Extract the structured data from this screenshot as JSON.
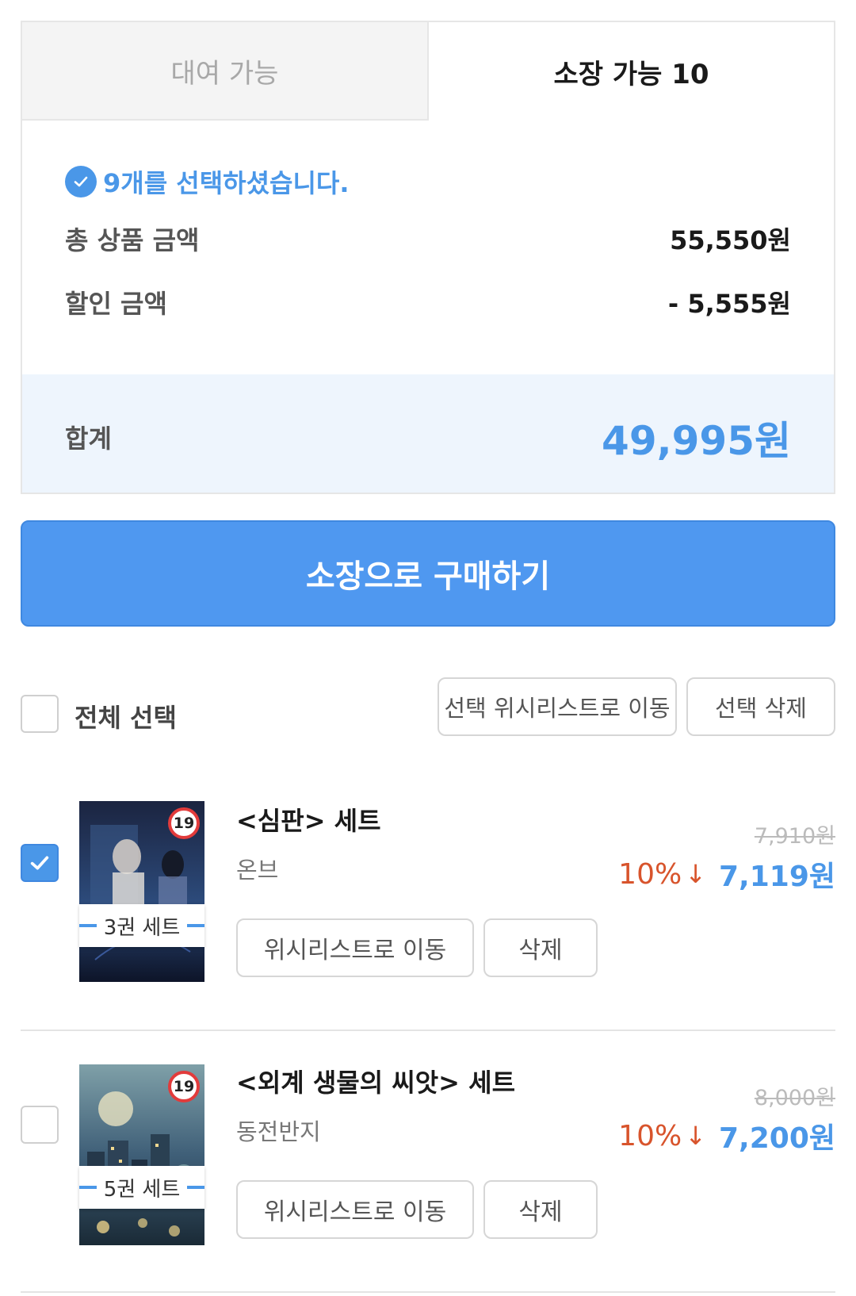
{
  "tabs": {
    "rent_label": "대여 가능",
    "own_label": "소장 가능 10"
  },
  "summary": {
    "selected_msg": "9개를 선택하셨습니다.",
    "total_label": "총 상품 금액",
    "total_value": "55,550원",
    "discount_label": "할인 금액",
    "discount_value": "- 5,555원",
    "sum_label": "합계",
    "sum_value": "49,995원",
    "accent_color": "#4a97e8"
  },
  "buy_button": "소장으로 구매하기",
  "select_bar": {
    "select_all_label": "전체 선택",
    "move_wishlist_label": "선택 위시리스트로 이동",
    "delete_label": "선택 삭제"
  },
  "items": [
    {
      "checked": true,
      "title": "<심판> 세트",
      "author": "온브",
      "set_label": "3권 세트",
      "age_rating": "19",
      "original_price": "7,910원",
      "discount_rate": "10%",
      "final_price": "7,119원",
      "wishlist_button": "위시리스트로 이동",
      "delete_button": "삭제"
    },
    {
      "checked": false,
      "title": "<외계 생물의 씨앗> 세트",
      "author": "동전반지",
      "set_label": "5권 세트",
      "age_rating": "19",
      "original_price": "8,000원",
      "discount_rate": "10%",
      "final_price": "7,200원",
      "wishlist_button": "위시리스트로 이동",
      "delete_button": "삭제"
    }
  ]
}
